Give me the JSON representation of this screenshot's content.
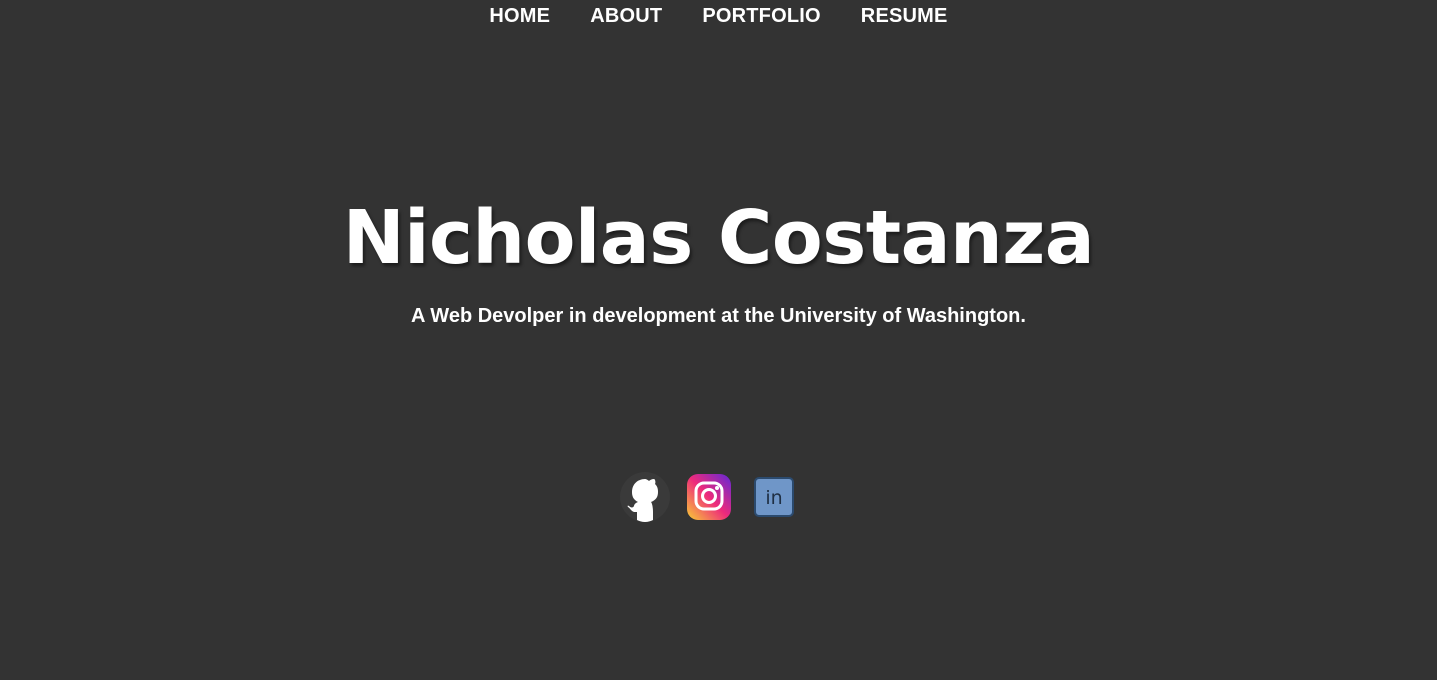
{
  "nav": {
    "items": [
      {
        "label": "HOME"
      },
      {
        "label": "ABOUT"
      },
      {
        "label": "PORTFOLIO"
      },
      {
        "label": "RESUME"
      }
    ]
  },
  "hero": {
    "name": "Nicholas Costanza",
    "tagline": "A Web Devolper in development at the University of Washington."
  },
  "social": {
    "links": [
      {
        "icon": "github-icon"
      },
      {
        "icon": "instagram-icon"
      },
      {
        "icon": "linkedin-icon"
      }
    ]
  },
  "colors": {
    "background": "#333333",
    "text": "#ffffff",
    "linkedin": "#6f96c8",
    "instagram_gradient": [
      "#f9ce34",
      "#ee2a7b",
      "#6228d7"
    ]
  }
}
